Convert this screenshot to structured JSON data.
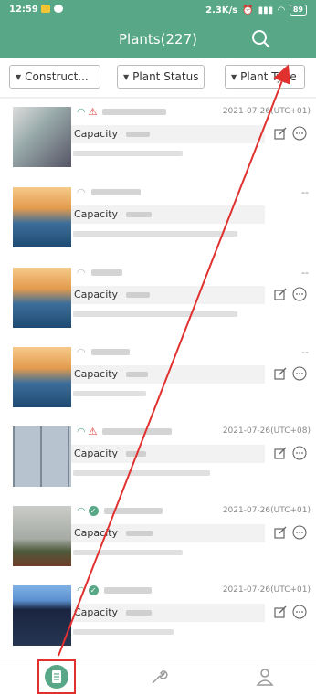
{
  "status_bar": {
    "time": "12:59",
    "net_speed": "2.3K/s",
    "battery": "89"
  },
  "header": {
    "title": "Plants(227)"
  },
  "filters": [
    {
      "label": "Construct..."
    },
    {
      "label": "Plant Status"
    },
    {
      "label": "Plant Type"
    }
  ],
  "plants": [
    {
      "date": "2021-07-26(UTC+01)",
      "capacity_label": "Capacity",
      "status": "online-alert"
    },
    {
      "date": "--",
      "capacity_label": "Capacity",
      "status": "offline"
    },
    {
      "date": "--",
      "capacity_label": "Capacity",
      "status": "offline"
    },
    {
      "date": "--",
      "capacity_label": "Capacity",
      "status": "offline"
    },
    {
      "date": "2021-07-26(UTC+08)",
      "capacity_label": "Capacity",
      "status": "online-alert"
    },
    {
      "date": "2021-07-26(UTC+01)",
      "capacity_label": "Capacity",
      "status": "online-ok"
    },
    {
      "date": "2021-07-26(UTC+01)",
      "capacity_label": "Capacity",
      "status": "online-ok"
    }
  ],
  "colors": {
    "brand": "#58a887",
    "highlight": "#e0312f",
    "arrow": "#e0312f"
  },
  "bottom_nav": [
    "plants-icon",
    "wrench-icon",
    "user-icon"
  ]
}
